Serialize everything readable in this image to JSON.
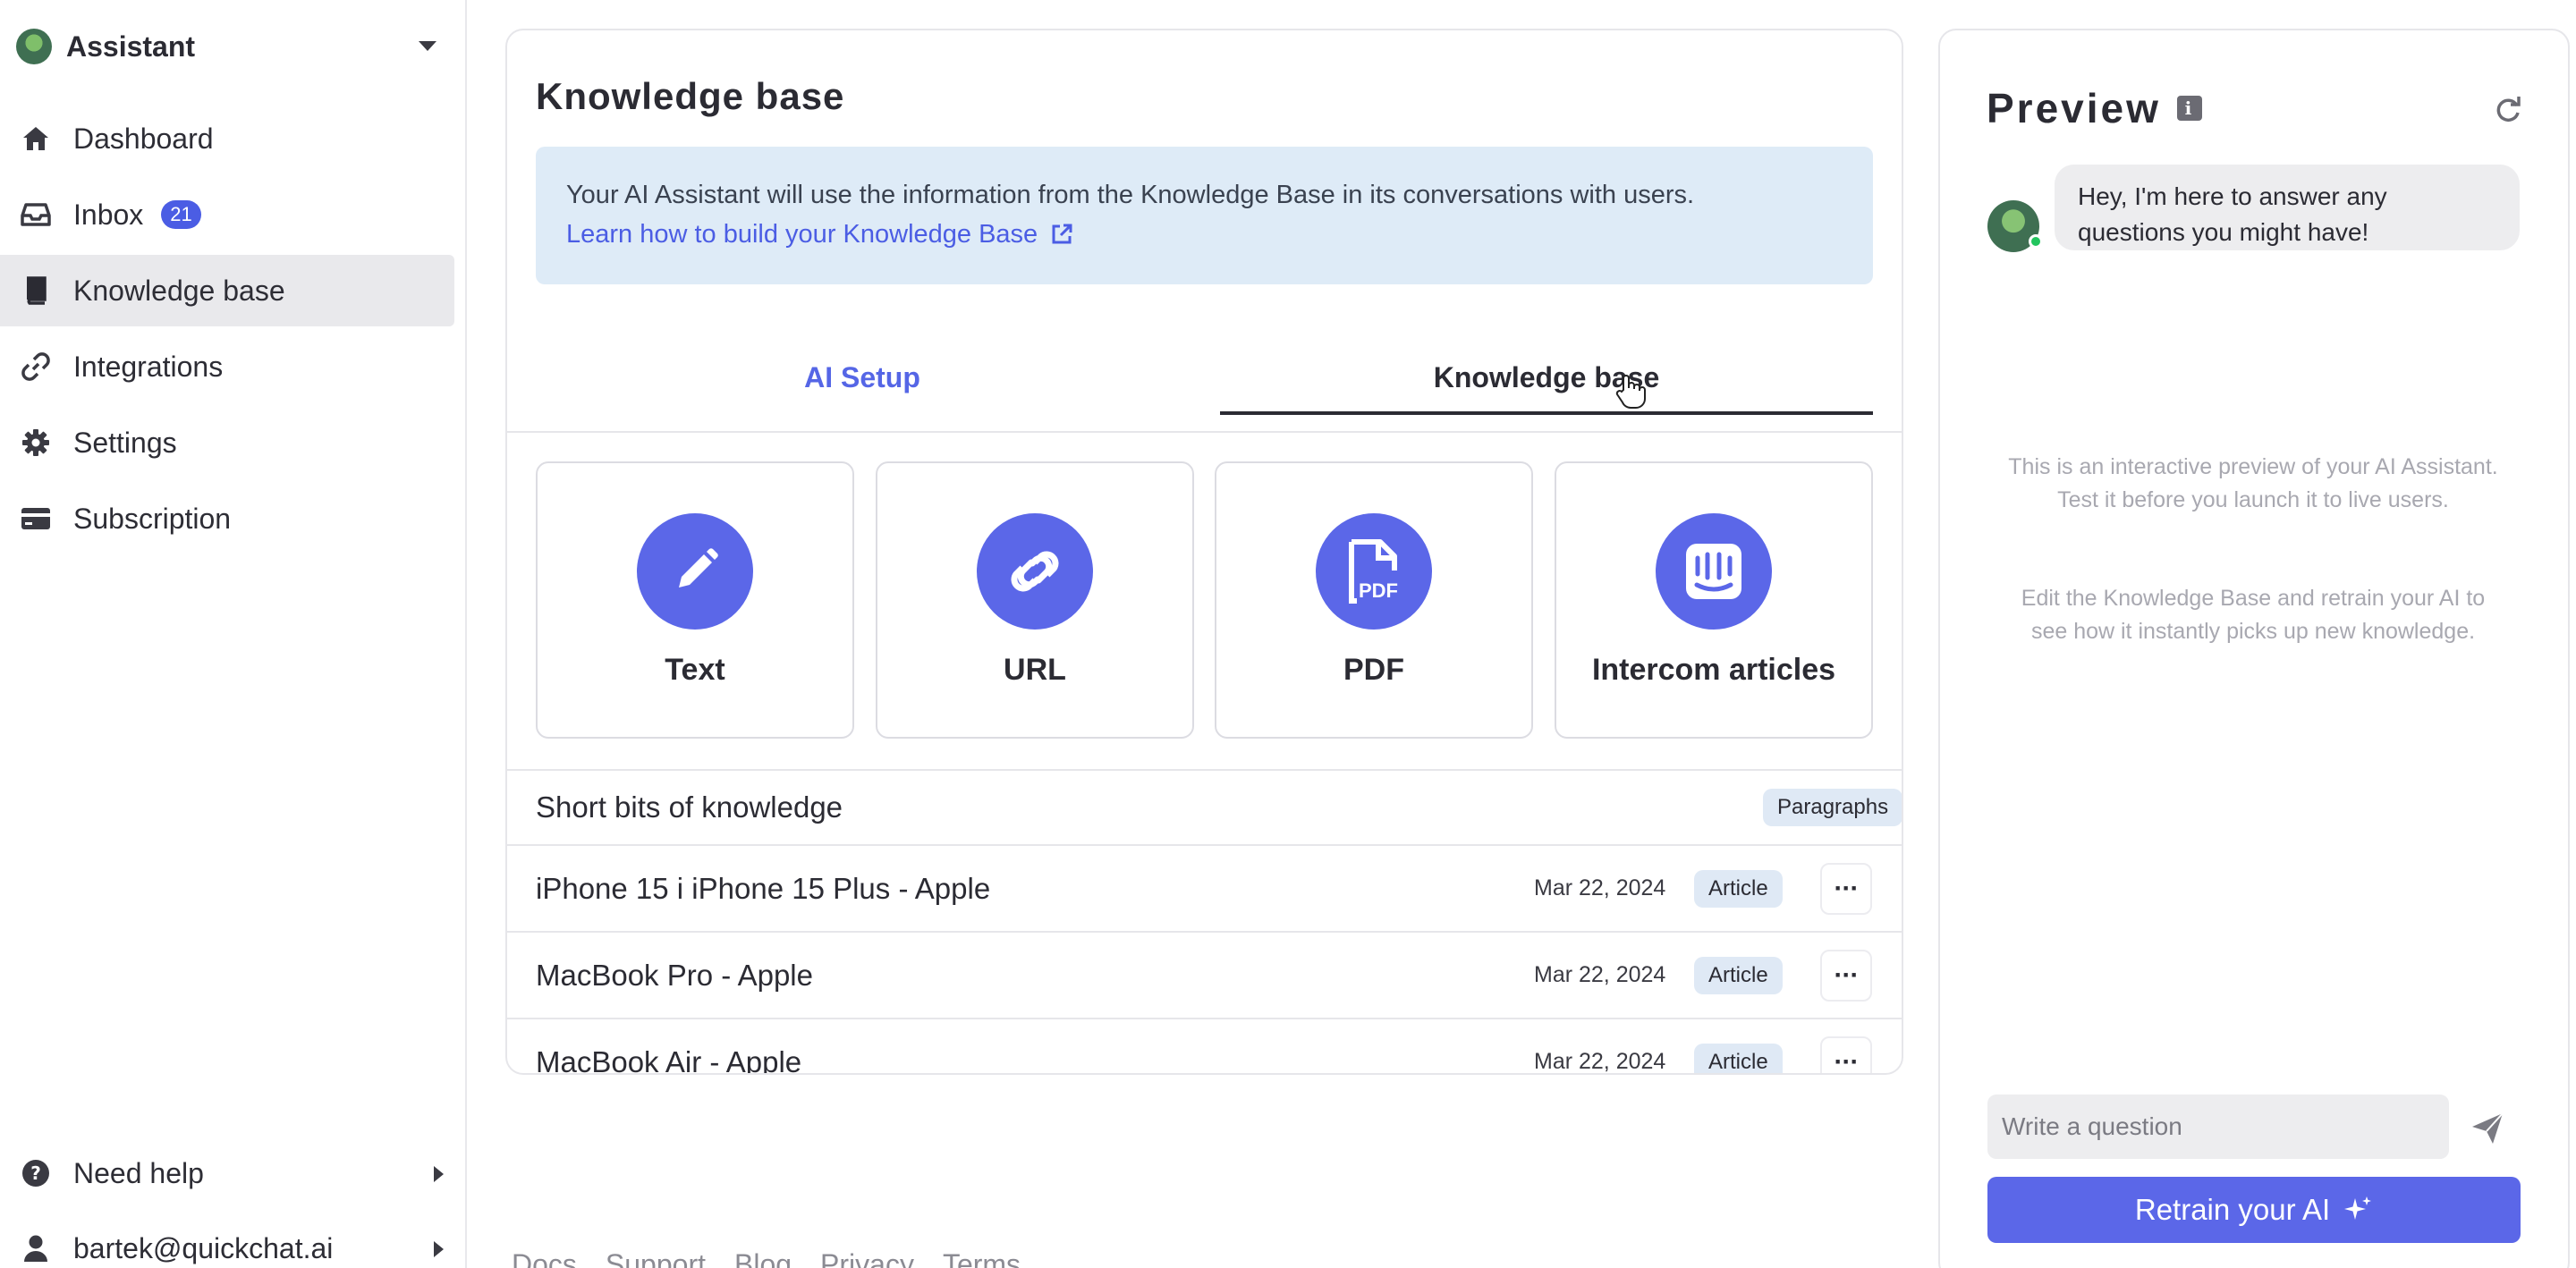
{
  "sidebar": {
    "brand": "Assistant",
    "items": [
      {
        "label": "Dashboard",
        "icon": "home-icon"
      },
      {
        "label": "Inbox",
        "icon": "inbox-icon",
        "badge": "21"
      },
      {
        "label": "Knowledge base",
        "icon": "book-icon",
        "active": true
      },
      {
        "label": "Integrations",
        "icon": "link-icon"
      },
      {
        "label": "Settings",
        "icon": "gear-icon"
      },
      {
        "label": "Subscription",
        "icon": "credit-card-icon"
      }
    ],
    "help_label": "Need help",
    "user_email": "bartek@quickchat.ai"
  },
  "main": {
    "title": "Knowledge base",
    "info": {
      "text": "Your AI Assistant will use the information from the Knowledge Base in its conversations with users.",
      "link": "Learn how to build your Knowledge Base"
    },
    "tabs": [
      {
        "label": "AI Setup",
        "active": false
      },
      {
        "label": "Knowledge base",
        "active": true
      }
    ],
    "sources": [
      {
        "label": "Text",
        "icon": "pencil-icon"
      },
      {
        "label": "URL",
        "icon": "chain-link-icon"
      },
      {
        "label": "PDF",
        "icon": "pdf-file-icon"
      },
      {
        "label": "Intercom articles",
        "icon": "intercom-icon"
      }
    ],
    "list": {
      "header": {
        "title": "Short bits of knowledge",
        "tag": "Paragraphs"
      },
      "items": [
        {
          "title": "iPhone 15 i iPhone 15 Plus - Apple",
          "date": "Mar 22, 2024",
          "tag": "Article",
          "more": "···"
        },
        {
          "title": "MacBook Pro - Apple",
          "date": "Mar 22, 2024",
          "tag": "Article",
          "more": "···"
        },
        {
          "title": "MacBook Air - Apple",
          "date": "Mar 22, 2024",
          "tag": "Article",
          "more": "···"
        }
      ]
    }
  },
  "footer": {
    "links": [
      "Docs",
      "Support",
      "Blog",
      "Privacy",
      "Terms"
    ]
  },
  "preview": {
    "title": "Preview",
    "greeting": "Hey, I'm here to answer any questions you might have!",
    "note1": "This is an interactive preview of your AI Assistant. Test it before you launch it to live users.",
    "note2": "Edit the Knowledge Base and retrain your AI to see how it instantly picks up new knowledge.",
    "input_placeholder": "Write a question",
    "retrain_label": "Retrain your AI"
  },
  "colors": {
    "accent": "#5b67e8",
    "link": "#4b5de4",
    "banner_bg": "#deebf7",
    "tag_bg": "#dfe9f5",
    "online": "#22c55e"
  }
}
